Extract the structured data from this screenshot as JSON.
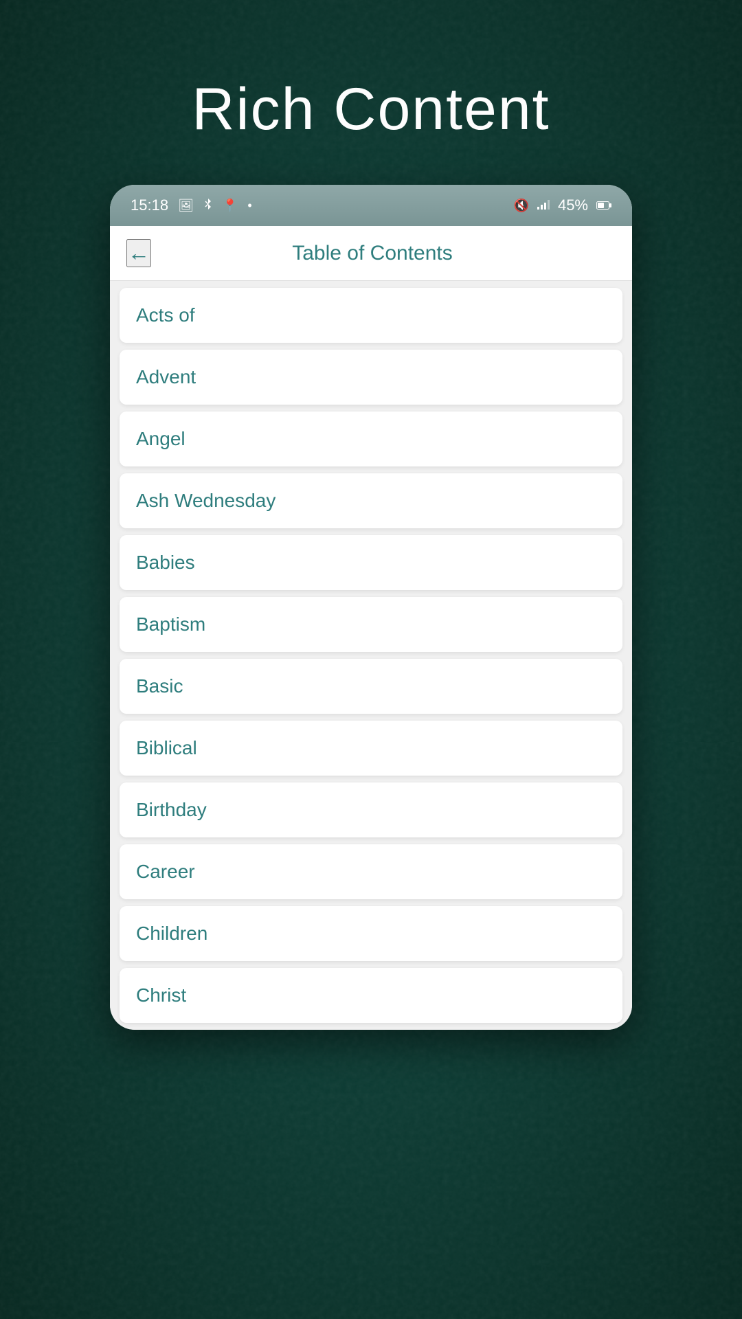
{
  "page": {
    "title": "Rich Content",
    "background_color": "#0d3d35"
  },
  "status_bar": {
    "time": "15:18",
    "battery": "45%",
    "icons": [
      "image",
      "bluetooth",
      "location",
      "dot",
      "mute",
      "signal",
      "battery"
    ]
  },
  "header": {
    "back_label": "←",
    "title": "Table of Contents"
  },
  "list": {
    "items": [
      {
        "id": 1,
        "label": "Acts of"
      },
      {
        "id": 2,
        "label": "Advent"
      },
      {
        "id": 3,
        "label": "Angel"
      },
      {
        "id": 4,
        "label": "Ash Wednesday"
      },
      {
        "id": 5,
        "label": "Babies"
      },
      {
        "id": 6,
        "label": "Baptism"
      },
      {
        "id": 7,
        "label": "Basic"
      },
      {
        "id": 8,
        "label": "Biblical"
      },
      {
        "id": 9,
        "label": "Birthday"
      },
      {
        "id": 10,
        "label": "Career"
      },
      {
        "id": 11,
        "label": "Children"
      },
      {
        "id": 12,
        "label": "Christ"
      }
    ]
  }
}
